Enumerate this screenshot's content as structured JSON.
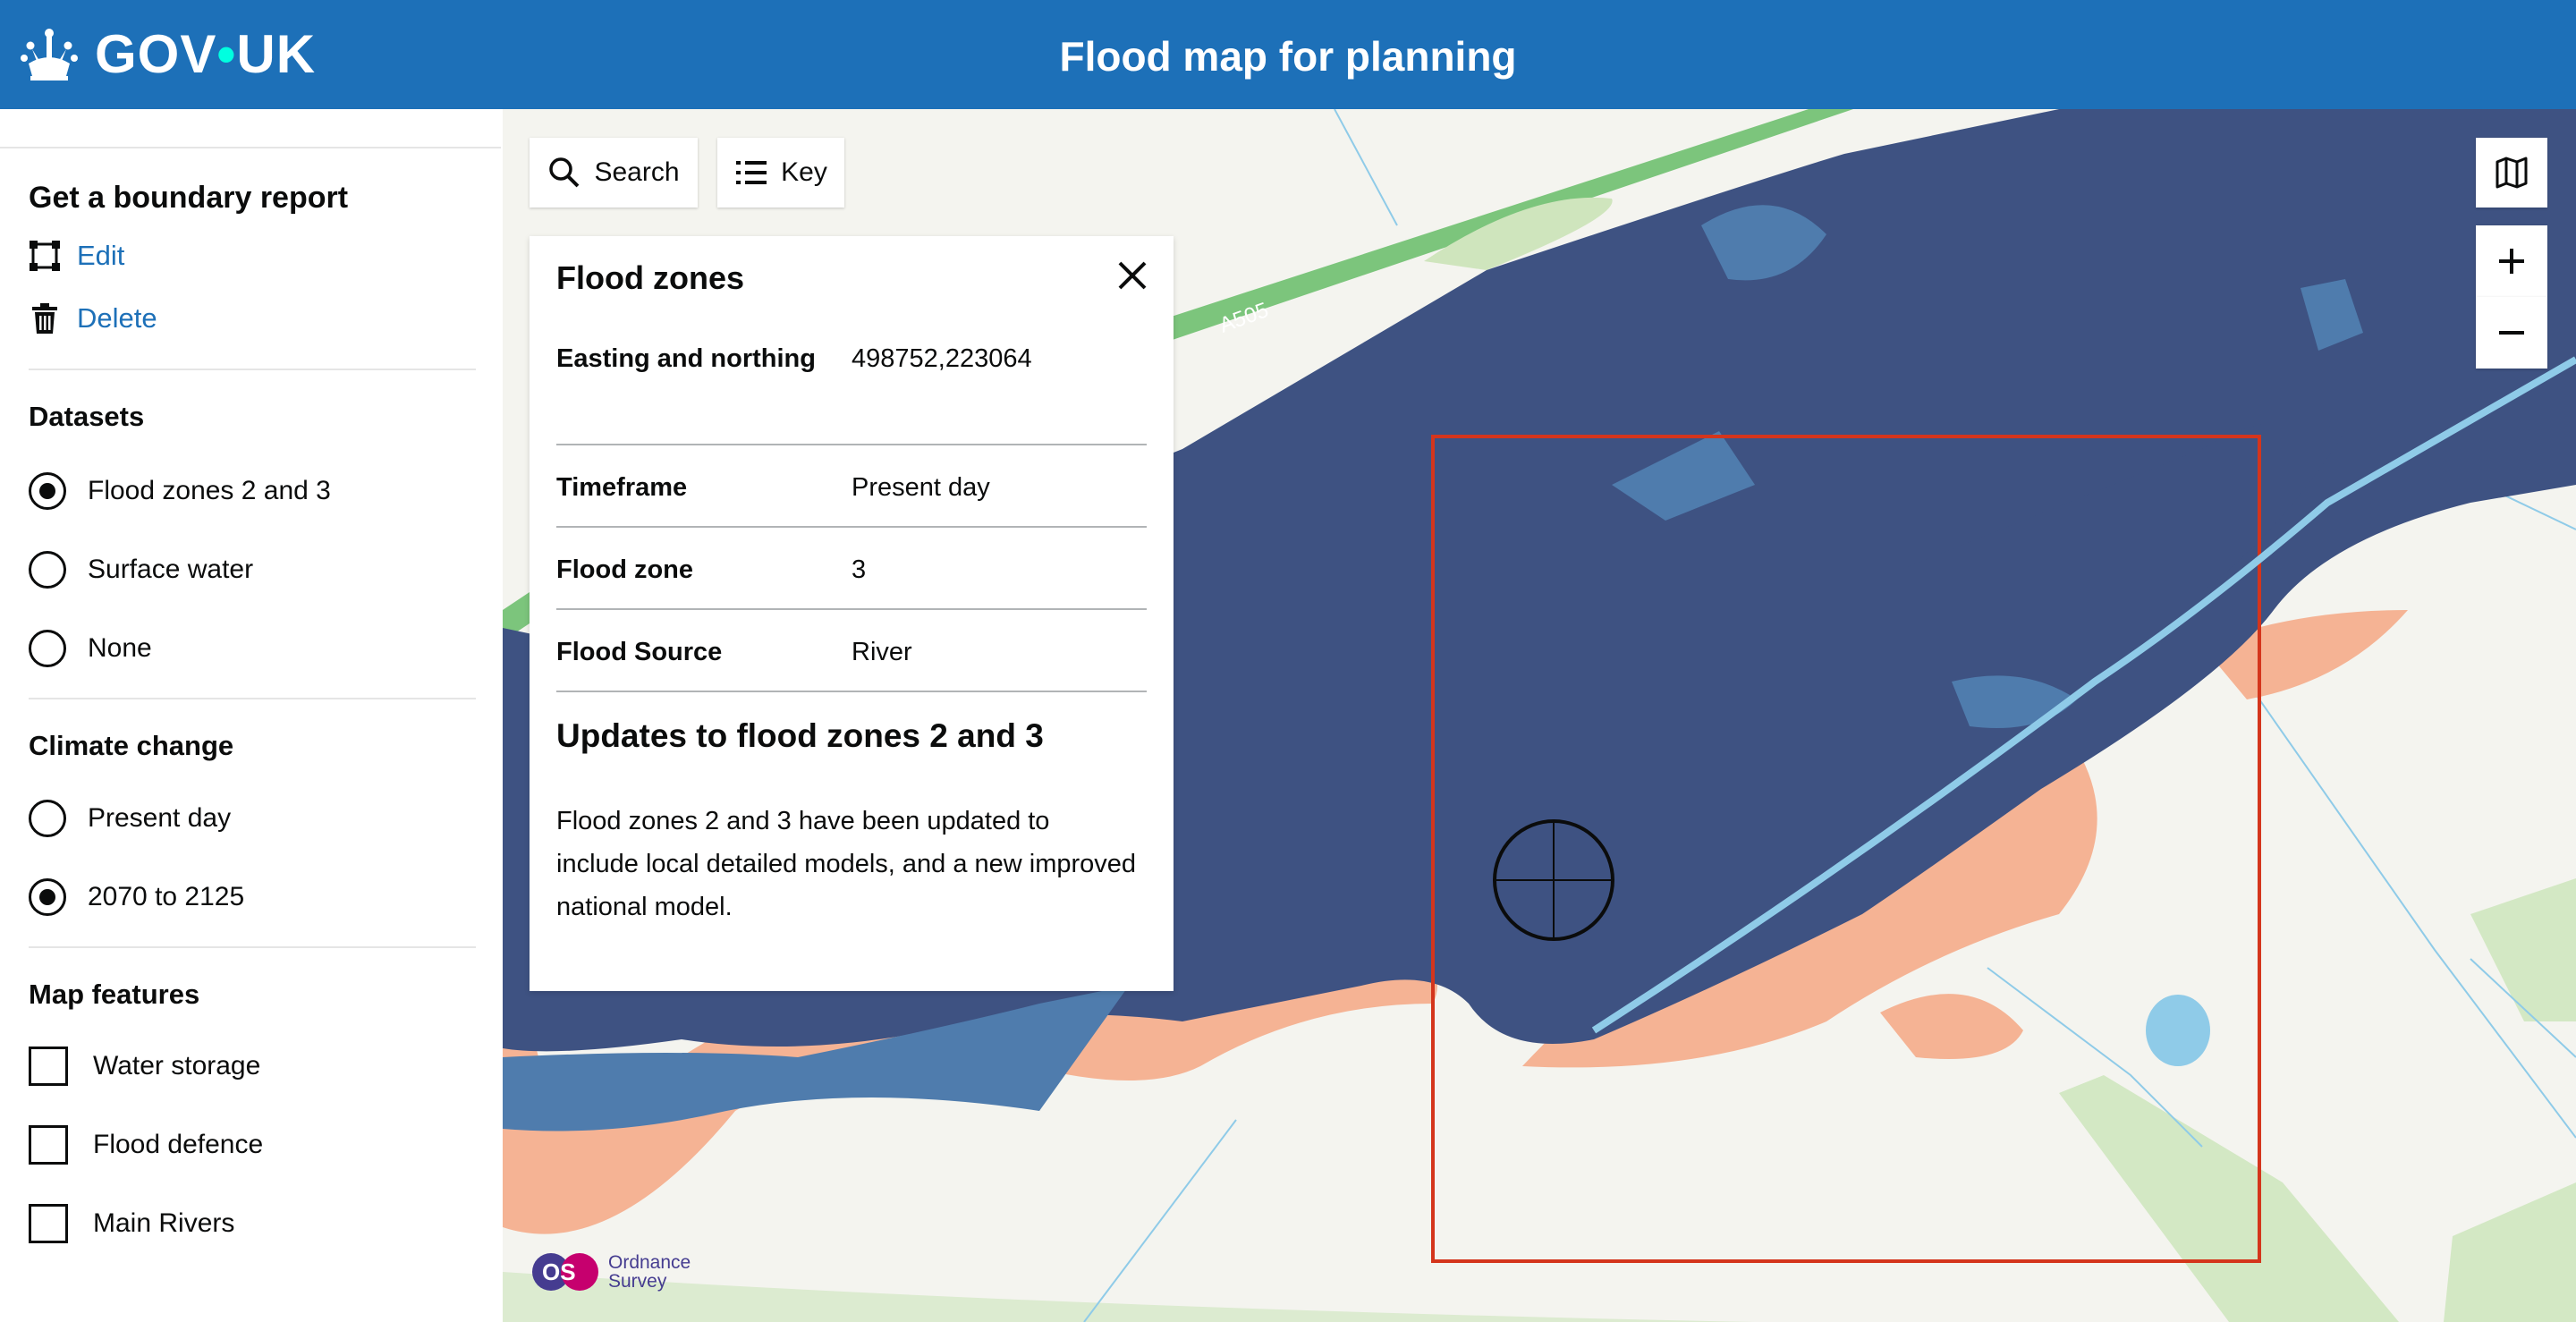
{
  "header": {
    "logo_text": "GOV",
    "logo_text2": "UK",
    "title": "Flood map for planning"
  },
  "sidebar": {
    "boundary_heading": "Get a boundary report",
    "edit_label": "Edit",
    "delete_label": "Delete",
    "datasets_heading": "Datasets",
    "datasets": [
      {
        "label": "Flood zones 2 and 3",
        "selected": true
      },
      {
        "label": "Surface water",
        "selected": false
      },
      {
        "label": "None",
        "selected": false
      }
    ],
    "climate_heading": "Climate change",
    "climate": [
      {
        "label": "Present day",
        "selected": false
      },
      {
        "label": "2070 to 2125",
        "selected": true
      }
    ],
    "features_heading": "Map features",
    "features": [
      {
        "label": "Water storage",
        "checked": false
      },
      {
        "label": "Flood defence",
        "checked": false
      },
      {
        "label": "Main Rivers",
        "checked": false
      }
    ]
  },
  "map": {
    "search_label": "Search",
    "key_label": "Key",
    "road_label": "A505",
    "attribution_line1": "Ordnance",
    "attribution_line2": "Survey",
    "icons": [
      "search-icon",
      "list-icon",
      "map-layers-icon",
      "zoom-in-icon",
      "zoom-out-icon",
      "crosshair-icon"
    ],
    "colors": {
      "zone3": "#3e5282",
      "zone3_light": "#4f7cad",
      "zone2": "#f5b394",
      "boundary": "#d4351c",
      "river": "#8fcbe8",
      "road": "#7cc57c"
    }
  },
  "panel": {
    "title": "Flood zones",
    "rows": [
      {
        "key": "Easting and northing",
        "value": "498752,223064"
      },
      {
        "key": "Timeframe",
        "value": "Present day"
      },
      {
        "key": "Flood zone",
        "value": "3"
      },
      {
        "key": "Flood Source",
        "value": "River"
      }
    ],
    "subheading": "Updates to flood zones 2 and 3",
    "body": "Flood zones 2 and 3 have been updated to include local detailed models, and a new improved national model."
  }
}
